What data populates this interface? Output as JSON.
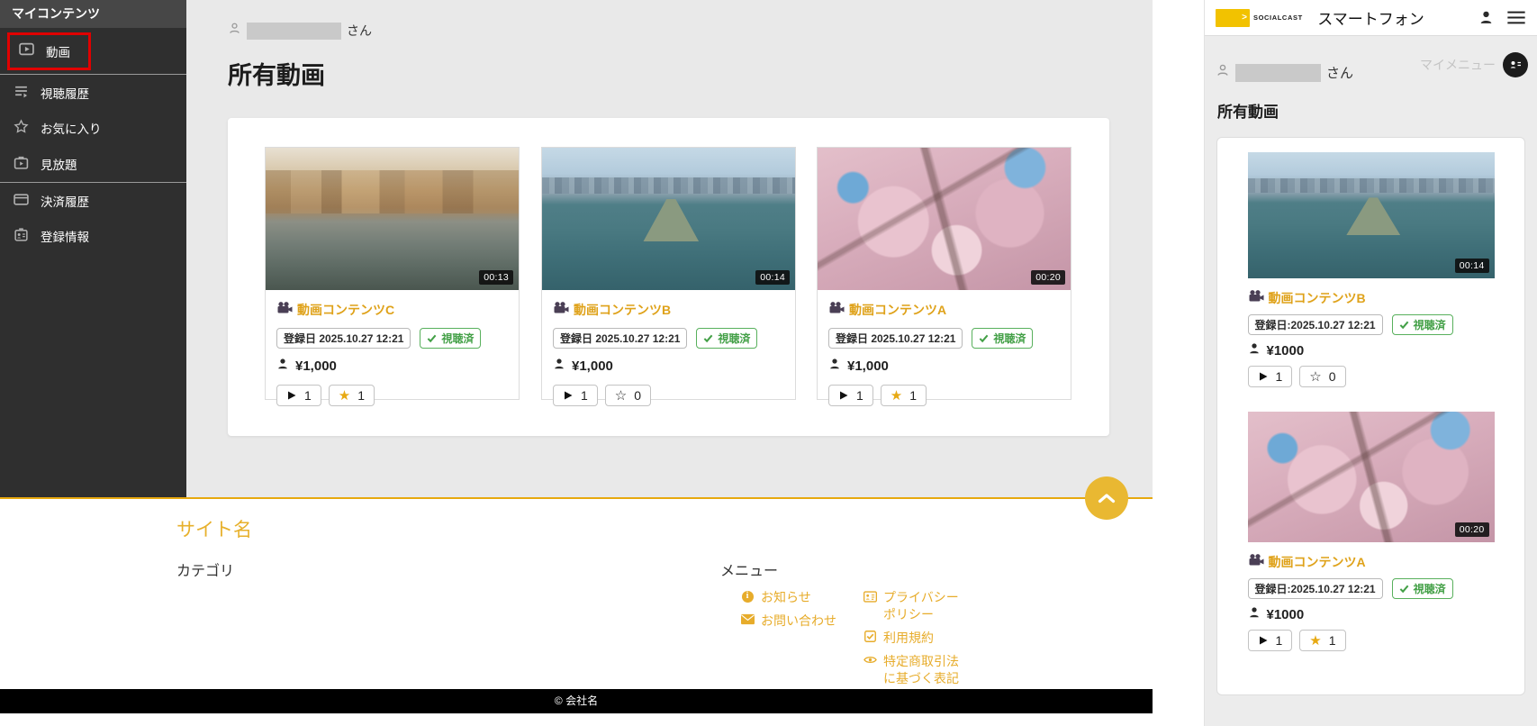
{
  "colors": {
    "accent_yellow": "#e7ac2b",
    "logo_yellow": "#f2c200",
    "active_highlight_red": "#e00000",
    "watched_green": "#43a047",
    "star_gold": "#e7a912",
    "sidebar_bg": "#2f2f2f",
    "main_bg": "#e9e9e9"
  },
  "sidebar": {
    "header": "マイコンテンツ",
    "items": [
      {
        "label": "動画",
        "icon": "video-play-icon",
        "active": true
      },
      {
        "label": "視聴履歴",
        "icon": "history-list-icon"
      },
      {
        "label": "お気に入り",
        "icon": "star-outline-icon"
      },
      {
        "label": "見放題",
        "icon": "all-you-can-watch-icon"
      },
      {
        "label": "決済履歴",
        "icon": "credit-card-icon"
      },
      {
        "label": "登録情報",
        "icon": "id-card-icon"
      }
    ]
  },
  "main": {
    "user_name_suffix": "さん",
    "page_title": "所有動画",
    "cards": [
      {
        "title": "動画コンテンツC",
        "registered": "登録日 2025.10.27 12:21",
        "watched": "視聴済",
        "price": "¥1,000",
        "play_count": "1",
        "star_count": "1",
        "star_glyph": "★",
        "star_class": "star-filled",
        "duration": "00:13",
        "image": "venice-canal"
      },
      {
        "title": "動画コンテンツB",
        "registered": "登録日 2025.10.27 12:21",
        "watched": "視聴済",
        "price": "¥1,000",
        "play_count": "1",
        "star_count": "0",
        "star_glyph": "☆",
        "star_class": "star-outline",
        "duration": "00:14",
        "image": "statue-of-liberty"
      },
      {
        "title": "動画コンテンツA",
        "registered": "登録日 2025.10.27 12:21",
        "watched": "視聴済",
        "price": "¥1,000",
        "play_count": "1",
        "star_count": "1",
        "star_glyph": "★",
        "star_class": "star-filled",
        "duration": "00:20",
        "image": "cherry-blossoms"
      }
    ]
  },
  "footer": {
    "site_name": "サイト名",
    "category_heading": "カテゴリ",
    "menu_heading": "メニュー",
    "links_left": [
      {
        "label": "お知らせ",
        "icon": "info-icon"
      },
      {
        "label": "お問い合わせ",
        "icon": "mail-icon"
      }
    ],
    "links_right": [
      {
        "label": "プライバシーポリシー",
        "icon": "privacy-card-icon"
      },
      {
        "label": "利用規約",
        "icon": "terms-check-icon"
      },
      {
        "label": "特定商取引法に基づく表記",
        "icon": "disclosure-eye-icon"
      }
    ],
    "copyright": "© 会社名"
  },
  "scroll_top": {
    "icon": "chevron-up-icon"
  },
  "phone": {
    "header": {
      "logo_text": "SOCIALCAST",
      "title": "スマートフォン"
    },
    "user_name_suffix": "さん",
    "my_menu_label": "マイメニュー",
    "page_title": "所有動画",
    "cards": [
      {
        "title": "動画コンテンツB",
        "registered": "登録日:2025.10.27 12:21",
        "watched": "視聴済",
        "price": "¥1000",
        "play_count": "1",
        "star_count": "0",
        "star_glyph": "☆",
        "star_class": "star-outline",
        "duration": "00:14",
        "image": "statue-of-liberty"
      },
      {
        "title": "動画コンテンツA",
        "registered": "登録日:2025.10.27 12:21",
        "watched": "視聴済",
        "price": "¥1000",
        "play_count": "1",
        "star_count": "1",
        "star_glyph": "★",
        "star_class": "star-filled",
        "duration": "00:20",
        "image": "cherry-blossoms"
      }
    ]
  }
}
